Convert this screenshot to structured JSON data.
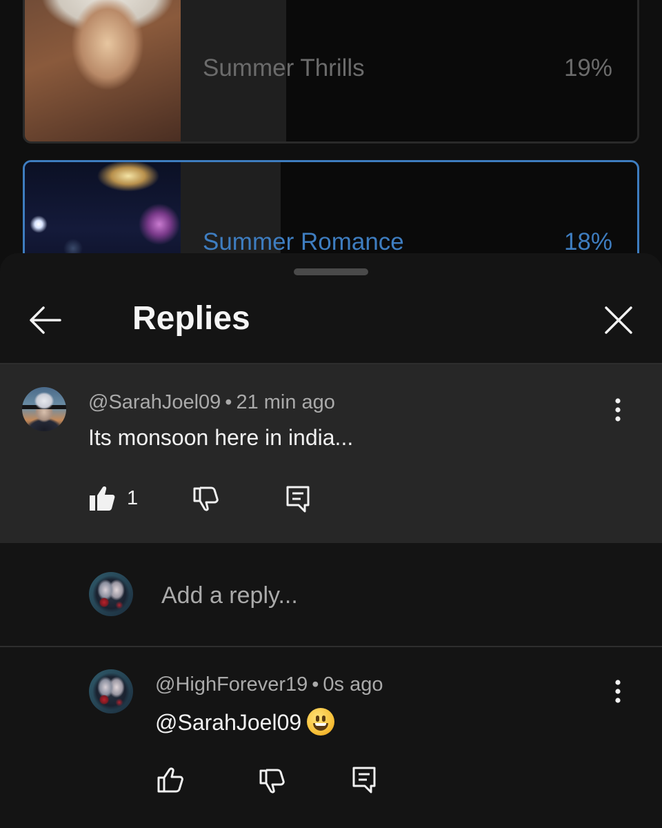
{
  "poll": {
    "options": [
      {
        "label": "Summer Thrills",
        "percent": "19%",
        "fill": 0.19,
        "selected": false
      },
      {
        "label": "Summer Romance",
        "percent": "18%",
        "fill": 0.18,
        "selected": true
      }
    ]
  },
  "sheet": {
    "title": "Replies",
    "back_icon": "arrow-left-icon",
    "close_icon": "close-icon"
  },
  "parent_comment": {
    "author": "@SarahJoel09",
    "time": "21 min ago",
    "text": "Its monsoon here in india...",
    "like_count": "1",
    "liked": true
  },
  "add_reply": {
    "placeholder": "Add a reply..."
  },
  "reply": {
    "author": "@HighForever19",
    "time": "0s ago",
    "text": "@SarahJoel09",
    "emoji": "grinning-face"
  },
  "colors": {
    "accent": "#3e7dc0",
    "sheet_bg": "#141414",
    "highlight_bg": "#272727",
    "secondary_text": "#aaaaaa"
  }
}
